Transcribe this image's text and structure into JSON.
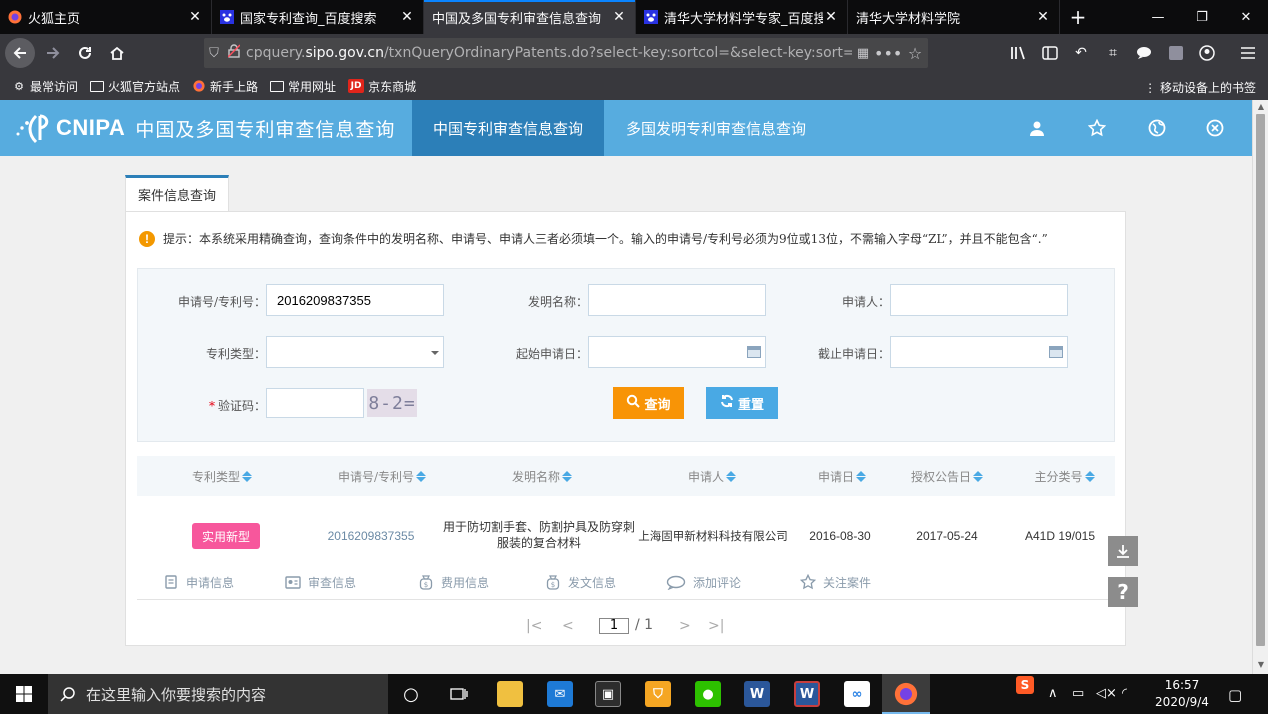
{
  "browser": {
    "tabs": [
      {
        "label": "火狐主页",
        "close": "✕",
        "active": false
      },
      {
        "label": "国家专利查询_百度搜索",
        "close": "✕",
        "active": false
      },
      {
        "label": "中国及多国专利审查信息查询",
        "close": "✕",
        "active": true
      },
      {
        "label": "清华大学材料学专家_百度搜索",
        "close": "✕",
        "active": false
      },
      {
        "label": "清华大学材料学院",
        "close": "✕",
        "active": false
      }
    ],
    "new_tab": "+",
    "url_prefix": "cpquery.",
    "url_domain": "sipo.gov.cn",
    "url_rest": "/txnQueryOrdinaryPatents.do?select-key:sortcol=&select-key:sort=&",
    "bookmarks": [
      "最常访问",
      "火狐官方站点",
      "新手上路",
      "常用网址",
      "京东商城"
    ],
    "mobile_bookmarks": "移动设备上的书签"
  },
  "site": {
    "logo_text": "CNIPA",
    "logo_cn": "中国及多国专利审查信息查询",
    "nav": [
      "中国专利审查信息查询",
      "多国发明专利审查信息查询"
    ]
  },
  "panel": {
    "tab_title": "案件信息查询",
    "notice": "提示：本系统采用精确查询，查询条件中的发明名称、申请号、申请人三者必须填一个。输入的申请号/专利号必须为9位或13位，不需输入字母“ZL”，并且不能包含“.”"
  },
  "form": {
    "app_no_label": "申请号/专利号：",
    "app_no_value": "2016209837355",
    "invention_label": "发明名称：",
    "invention_value": "",
    "applicant_label": "申请人：",
    "applicant_value": "",
    "type_label": "专利类型：",
    "type_value": "",
    "start_date_label": "起始申请日：",
    "start_date_value": "",
    "end_date_label": "截止申请日：",
    "end_date_value": "",
    "captcha_label": "验证码：",
    "captcha_required": "*",
    "captcha_value": "",
    "captcha_image": "8-2=",
    "query_button": "查询",
    "reset_button": "重置"
  },
  "table": {
    "headers": [
      "专利类型",
      "申请号/专利号",
      "发明名称",
      "申请人",
      "申请日",
      "授权公告日",
      "主分类号"
    ],
    "row": {
      "type": "实用新型",
      "app_no": "2016209837355",
      "title": "用于防切割手套、防割护具及防穿刺服装的复合材料",
      "applicant": "上海固甲新材料科技有限公司",
      "filing_date": "2016-08-30",
      "grant_date": "2017-05-24",
      "ipc": "A41D 19/015"
    },
    "actions": [
      "申请信息",
      "审查信息",
      "费用信息",
      "发文信息",
      "添加评论",
      "关注案件"
    ]
  },
  "pagination": {
    "first": "|<",
    "prev": "<",
    "current": "1",
    "total": "/ 1",
    "next": ">",
    "last": ">|"
  },
  "taskbar": {
    "search_placeholder": "在这里输入你要搜索的内容",
    "time": "16:57",
    "date": "2020/9/4"
  },
  "colors": {
    "header_blue": "#57acdf",
    "nav_active": "#2c7fb8",
    "query_orange": "#f89406",
    "reset_blue": "#49a9e4",
    "badge_pink": "#f7579c"
  }
}
